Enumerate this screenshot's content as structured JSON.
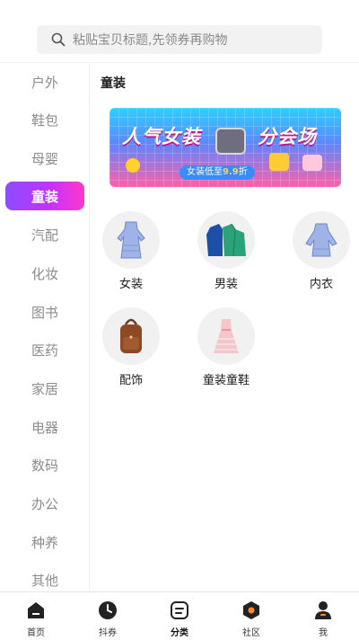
{
  "search": {
    "placeholder": "粘贴宝贝标题,先领券再购物"
  },
  "sidebar": {
    "items": [
      {
        "label": "户外"
      },
      {
        "label": "鞋包"
      },
      {
        "label": "母婴"
      },
      {
        "label": "童装",
        "active": true
      },
      {
        "label": "汽配"
      },
      {
        "label": "化妆"
      },
      {
        "label": "图书"
      },
      {
        "label": "医药"
      },
      {
        "label": "家居"
      },
      {
        "label": "电器"
      },
      {
        "label": "数码"
      },
      {
        "label": "办公"
      },
      {
        "label": "种养"
      },
      {
        "label": "其他"
      }
    ]
  },
  "content": {
    "title": "童装",
    "banner": {
      "text_left": "人气女装",
      "text_right": "分会场",
      "pill_text": "女装低至",
      "pill_price": "9.9",
      "pill_unit": "折"
    },
    "categories": [
      {
        "label": "女装",
        "icon": "dress-icon"
      },
      {
        "label": "男装",
        "icon": "jacket-icon"
      },
      {
        "label": "内衣",
        "icon": "blouse-icon"
      },
      {
        "label": "配饰",
        "icon": "backpack-icon"
      },
      {
        "label": "童装童鞋",
        "icon": "kids-dress-icon"
      }
    ]
  },
  "tabbar": {
    "tabs": [
      {
        "label": "首页",
        "icon": "home-icon"
      },
      {
        "label": "抖券",
        "icon": "clock-icon"
      },
      {
        "label": "分类",
        "icon": "category-icon",
        "active": true
      },
      {
        "label": "社区",
        "icon": "community-icon"
      },
      {
        "label": "我",
        "icon": "profile-icon"
      }
    ]
  },
  "colors": {
    "accent_start": "#8b4dff",
    "accent_end": "#ff38c8",
    "tab_icon": "#222222"
  }
}
